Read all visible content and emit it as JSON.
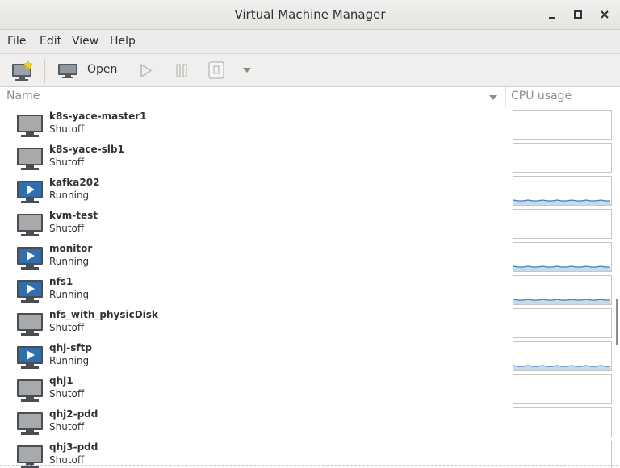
{
  "window": {
    "title": "Virtual Machine Manager"
  },
  "menu": {
    "file": "File",
    "edit": "Edit",
    "view": "View",
    "help": "Help"
  },
  "toolbar": {
    "open_label": "Open"
  },
  "columns": {
    "name": "Name",
    "cpu": "CPU usage"
  },
  "colors": {
    "running_blue": "#2f6fb0",
    "graph_line": "#3d7fbf",
    "graph_fill": "#c6daea"
  },
  "vms": [
    {
      "name": "k8s-yace-master1",
      "status": "Shutoff",
      "running": false
    },
    {
      "name": "k8s-yace-slb1",
      "status": "Shutoff",
      "running": false
    },
    {
      "name": "kafka202",
      "status": "Running",
      "running": true
    },
    {
      "name": "kvm-test",
      "status": "Shutoff",
      "running": false
    },
    {
      "name": "monitor",
      "status": "Running",
      "running": true
    },
    {
      "name": "nfs1",
      "status": "Running",
      "running": true
    },
    {
      "name": "nfs_with_physicDisk",
      "status": "Shutoff",
      "running": false
    },
    {
      "name": "qhj-sftp",
      "status": "Running",
      "running": true
    },
    {
      "name": "qhj1",
      "status": "Shutoff",
      "running": false
    },
    {
      "name": "qhj2-pdd",
      "status": "Shutoff",
      "running": false
    },
    {
      "name": "qhj3-pdd",
      "status": "Shutoff",
      "running": false
    }
  ]
}
